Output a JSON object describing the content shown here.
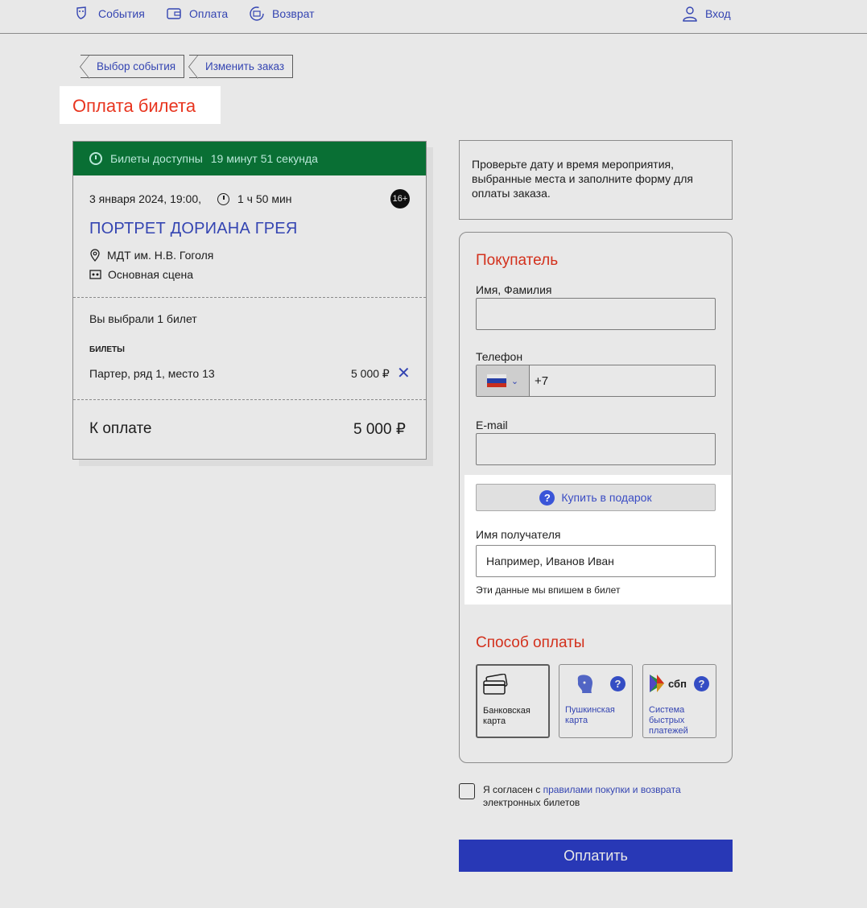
{
  "nav": {
    "events": "События",
    "payment": "Оплата",
    "refund": "Возврат",
    "login": "Вход"
  },
  "breadcrumbs": [
    "Выбор события",
    "Изменить заказ"
  ],
  "page_title": "Оплата билета",
  "timer": {
    "label": "Билеты доступны",
    "remaining": "19 минут 51 секунда"
  },
  "event": {
    "date": "3 января 2024, 19:00,",
    "duration": "1 ч 50 мин",
    "age": "16+",
    "title": "ПОРТРЕТ ДОРИАНА ГРЕЯ",
    "venue": "МДТ им. Н.В. Гоголя",
    "hall": "Основная сцена"
  },
  "selection": {
    "count_text": "Вы выбрали 1 билет",
    "tickets_header": "БИЛЕТЫ",
    "ticket": "Партер, ряд 1, место 13",
    "price": "5 000  ₽"
  },
  "total": {
    "label": "К оплате",
    "value": "5 000 ₽"
  },
  "info_text": "Проверьте дату и время мероприятия, выбранные места и заполните форму для оплаты заказа.",
  "buyer": {
    "title": "Покупатель",
    "name_label": "Имя, Фамилия",
    "name_value": "",
    "phone_label": "Телефон",
    "phone_value": "+7",
    "email_label": "E-mail",
    "email_value": ""
  },
  "gift": {
    "button": "Купить в подарок",
    "recipient_label": "Имя получателя",
    "recipient_value": "Например, Иванов Иван",
    "hint": "Эти данные мы впишем в билет"
  },
  "payment": {
    "title": "Способ оплаты",
    "options": [
      {
        "label": "Банковская карта",
        "icon": "bank-card-icon",
        "selected": true
      },
      {
        "label": "Пушкинская карта",
        "icon": "pushkin-card-icon",
        "selected": false
      },
      {
        "label": "Система быстрых платежей",
        "icon": "sbp-icon",
        "logo_text": "сбп",
        "selected": false
      }
    ]
  },
  "agreement": {
    "prefix": "Я согласен с",
    "link": "правилами покупки и возврата",
    "suffix": "электронных билетов"
  },
  "pay_button": "Оплатить",
  "colors": {
    "accent": "#3a4cc4",
    "red": "#e8351f",
    "green": "#0a7a3a",
    "pay_button": "#2d3ec9"
  }
}
